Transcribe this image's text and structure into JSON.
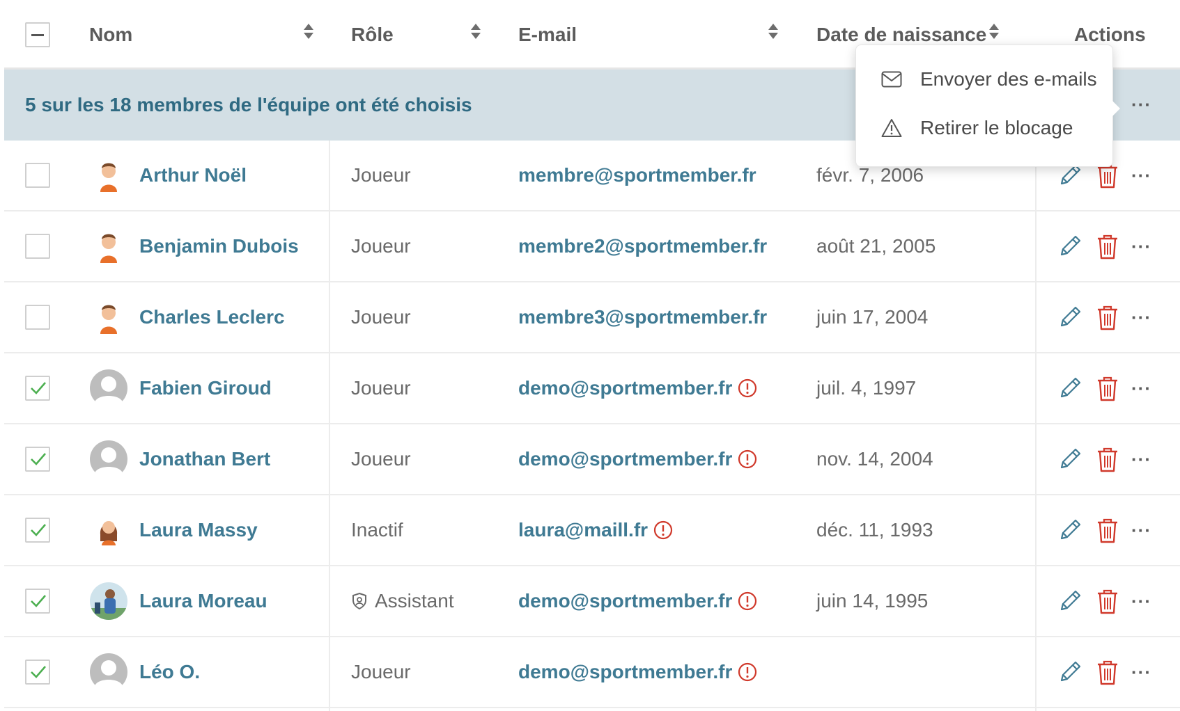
{
  "header": {
    "select_all_state": "indeterminate",
    "col_name": "Nom",
    "col_role": "Rôle",
    "col_email": "E-mail",
    "col_birth": "Date de naissance",
    "col_actions": "Actions"
  },
  "banner": {
    "text": "5 sur les 18 membres de l'équipe ont été choisis",
    "more_label": "···"
  },
  "menu": {
    "items": [
      {
        "icon": "envelope-icon",
        "label": "Envoyer des e-mails"
      },
      {
        "icon": "warning-triangle-icon",
        "label": "Retirer le blocage"
      }
    ]
  },
  "colors": {
    "accent": "#3f7a93",
    "banner_bg": "#d3dfe5",
    "danger": "#d0392b",
    "check": "#4caf50"
  },
  "rows": [
    {
      "checked": false,
      "avatar": "player-avatar",
      "name": "Arthur Noël",
      "role": "Joueur",
      "role_icon": "",
      "email": "membre@sportmember.fr",
      "email_warning": false,
      "birth": "févr. 7, 2006",
      "more": "···"
    },
    {
      "checked": false,
      "avatar": "player-avatar",
      "name": "Benjamin Dubois",
      "role": "Joueur",
      "role_icon": "",
      "email": "membre2@sportmember.fr",
      "email_warning": false,
      "birth": "août 21, 2005",
      "more": "···"
    },
    {
      "checked": false,
      "avatar": "player-avatar",
      "name": "Charles Leclerc",
      "role": "Joueur",
      "role_icon": "",
      "email": "membre3@sportmember.fr",
      "email_warning": false,
      "birth": "juin 17, 2004",
      "more": "···"
    },
    {
      "checked": true,
      "avatar": "default-avatar",
      "name": "Fabien Giroud",
      "role": "Joueur",
      "role_icon": "",
      "email": "demo@sportmember.fr",
      "email_warning": true,
      "birth": "juil. 4, 1997",
      "more": "···"
    },
    {
      "checked": true,
      "avatar": "default-avatar",
      "name": "Jonathan Bert",
      "role": "Joueur",
      "role_icon": "",
      "email": "demo@sportmember.fr",
      "email_warning": true,
      "birth": "nov. 14, 2004",
      "more": "···"
    },
    {
      "checked": true,
      "avatar": "female-avatar",
      "name": "Laura Massy",
      "role": "Inactif",
      "role_icon": "",
      "email": "laura@maill.fr",
      "email_warning": true,
      "birth": "déc. 11, 1993",
      "more": "···"
    },
    {
      "checked": true,
      "avatar": "photo-avatar",
      "name": "Laura Moreau",
      "role": "Assistant",
      "role_icon": "shield-user-icon",
      "email": "demo@sportmember.fr",
      "email_warning": true,
      "birth": "juin 14, 1995",
      "more": "···"
    },
    {
      "checked": true,
      "avatar": "default-avatar",
      "name": "Léo O.",
      "role": "Joueur",
      "role_icon": "",
      "email": "demo@sportmember.fr",
      "email_warning": true,
      "birth": "",
      "more": "···"
    }
  ]
}
